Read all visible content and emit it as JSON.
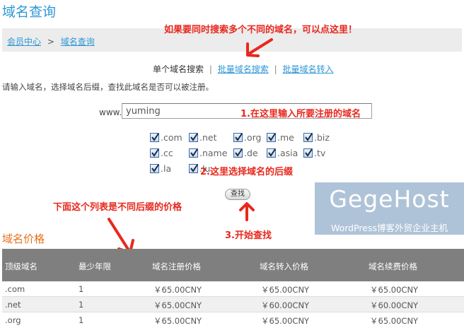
{
  "page": {
    "title": "域名查询"
  },
  "breadcrumb": {
    "home": "会员中心",
    "separator": ">",
    "current": "域名查询"
  },
  "notes": {
    "top": "如果要同时搜索多个不同的域名，可以点这里！",
    "input": "1.在这里输入所要注册的域名",
    "tld": "2.这里选择域名的后缀",
    "search": "3.开始查找",
    "list": "下面这个列表是不同后缀的价格"
  },
  "mode_tabs": {
    "single": "单个域名搜索",
    "sep1": "|",
    "bulk_search": "批量域名搜索",
    "sep2": "|",
    "bulk_transfer": "批量域名转入"
  },
  "intro": "请输入域名，选择域名后缀，查找此域名是否可以被注册。",
  "search_form": {
    "prefix": "www.",
    "value": "yuming",
    "search_button": "查找"
  },
  "tlds": [
    {
      "label": ".com",
      "checked": true
    },
    {
      "label": ".net",
      "checked": true
    },
    {
      "label": ".org",
      "checked": true
    },
    {
      "label": ".me",
      "checked": true
    },
    {
      "label": ".biz",
      "checked": true
    },
    {
      "label": ".cc",
      "checked": true
    },
    {
      "label": ".name",
      "checked": true
    },
    {
      "label": ".de",
      "checked": true
    },
    {
      "label": ".asia",
      "checked": true
    },
    {
      "label": ".tv",
      "checked": true
    },
    {
      "label": ".la",
      "checked": true
    },
    {
      "label": ".lu",
      "checked": true
    }
  ],
  "watermark": {
    "brand": "GegeHost",
    "tagline": "WordPress博客外贸企业主机"
  },
  "price_section": {
    "heading": "域名价格",
    "columns": [
      "顶级域名",
      "最少年限",
      "域名注册价格",
      "域名转入价格",
      "域名续费价格"
    ],
    "rows": [
      [
        ".com",
        "1",
        "￥65.00CNY",
        "￥65.00CNY",
        "￥65.00CNY"
      ],
      [
        ".net",
        "1",
        "￥65.00CNY",
        "￥60.00CNY",
        "￥60.00CNY"
      ],
      [
        ".org",
        "1",
        "￥65.00CNY",
        "￥65.00CNY",
        "￥65.00CNY"
      ]
    ]
  },
  "colors": {
    "link": "#2d97d6",
    "note": "#e8281e",
    "heading": "#e8711a",
    "table_header": "#7f7f7f",
    "arrow": "#e8281e"
  }
}
